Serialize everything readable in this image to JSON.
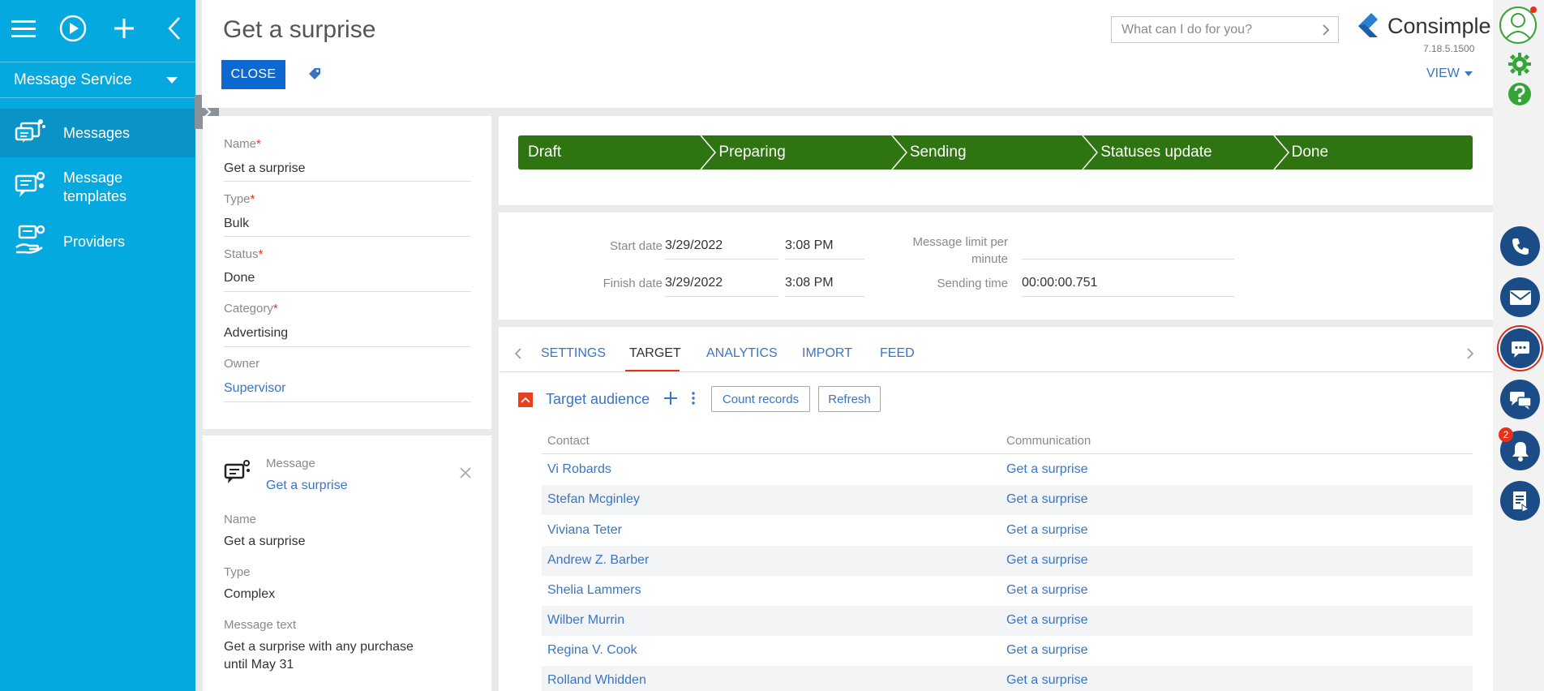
{
  "sidebar": {
    "section": "Message Service",
    "items": [
      {
        "label": "Messages",
        "icon": "messages-icon"
      },
      {
        "label": "Message templates",
        "icon": "message-templates-icon"
      },
      {
        "label": "Providers",
        "icon": "providers-icon"
      }
    ]
  },
  "header": {
    "title": "Get a surprise",
    "close_label": "CLOSE",
    "search_placeholder": "What can I do for you?",
    "brand": "Consimple",
    "version": "7.18.5.1500",
    "view_label": "VIEW"
  },
  "details": {
    "name_label": "Name",
    "name_value": "Get a surprise",
    "type_label": "Type",
    "type_value": "Bulk",
    "status_label": "Status",
    "status_value": "Done",
    "category_label": "Category",
    "category_value": "Advertising",
    "owner_label": "Owner",
    "owner_value": "Supervisor"
  },
  "message_card": {
    "header_label": "Message",
    "header_link": "Get a surprise",
    "name_label": "Name",
    "name_value": "Get a surprise",
    "type_label": "Type",
    "type_value": "Complex",
    "text_label": "Message text",
    "text_line1": "Get a surprise with any purchase",
    "text_line2": "until May 31"
  },
  "stages": [
    "Draft",
    "Preparing",
    "Sending",
    "Statuses update",
    "Done"
  ],
  "dates": {
    "start_label": "Start date",
    "start_date": "3/29/2022",
    "start_time": "3:08 PM",
    "finish_label": "Finish date",
    "finish_date": "3/29/2022",
    "finish_time": "3:08 PM",
    "limit_label_1": "Message limit per",
    "limit_label_2": "minute",
    "limit_value": "",
    "sending_label": "Sending time",
    "sending_value": "00:00:00.751"
  },
  "tabs": [
    "SETTINGS",
    "TARGET",
    "ANALYTICS",
    "IMPORT",
    "FEED"
  ],
  "target": {
    "title": "Target audience",
    "count_label": "Count records",
    "refresh_label": "Refresh",
    "col_contact": "Contact",
    "col_communication": "Communication",
    "rows": [
      {
        "contact": "Vi Robards",
        "communication": "Get a surprise"
      },
      {
        "contact": "Stefan Mcginley",
        "communication": "Get a surprise"
      },
      {
        "contact": "Viviana Teter",
        "communication": "Get a surprise"
      },
      {
        "contact": "Andrew Z. Barber",
        "communication": "Get a surprise"
      },
      {
        "contact": "Shelia Lammers",
        "communication": "Get a surprise"
      },
      {
        "contact": "Wilber Murrin",
        "communication": "Get a surprise"
      },
      {
        "contact": "Regina V. Cook",
        "communication": "Get a surprise"
      },
      {
        "contact": "Rolland Whidden",
        "communication": "Get a surprise"
      }
    ]
  },
  "notifications_count": "2",
  "colors": {
    "nav": "#04a9e0",
    "primary_button": "#0d69d0",
    "stage_green": "#2e7410",
    "link": "#3a75c4",
    "accent_red": "#e8311b"
  }
}
